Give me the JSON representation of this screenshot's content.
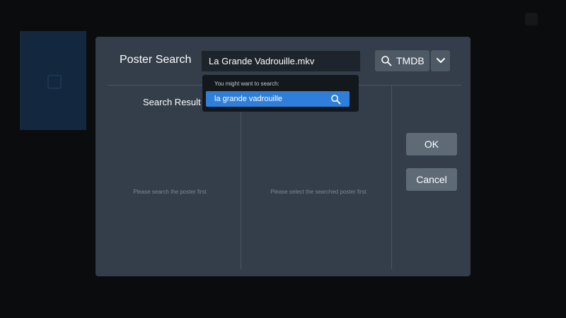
{
  "background": {
    "tile_color": "#13283f"
  },
  "dialog": {
    "title": "Poster Search",
    "search_value": "La Grande Vadrouille.mkv",
    "source_button": {
      "label": "TMDB",
      "icon": "search-icon"
    },
    "dropdown_icon": "chevron-down-icon",
    "search_result_title": "Search Result",
    "placeholder_left": "Please search the poster first",
    "placeholder_middle": "Please select the searched poster first",
    "ok_label": "OK",
    "cancel_label": "Cancel"
  },
  "suggestions": {
    "heading": "You might want to search:",
    "items": [
      {
        "label": "la grande vadrouille",
        "icon": "search-icon"
      }
    ]
  },
  "colors": {
    "dialog_bg": "#333e4a",
    "accent": "#2f7fda",
    "button_bg": "#5e6b77"
  }
}
